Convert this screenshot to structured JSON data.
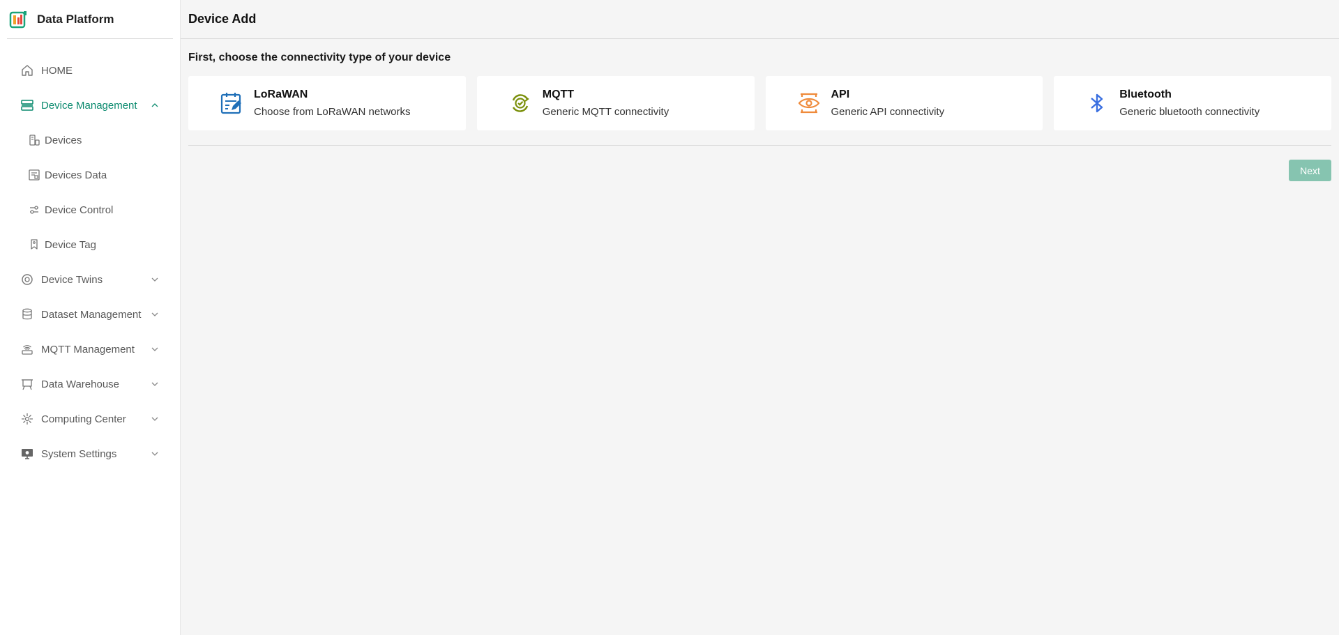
{
  "app": {
    "name": "Data Platform",
    "logo_icon": "data-platform-logo"
  },
  "colors": {
    "accent": "#0a8a6e",
    "lorawan": "#1f6fb8",
    "mqtt": "#7a8f0a",
    "api": "#ef8a3a",
    "bluetooth": "#3a6fe0",
    "next_button": "#86c4b0"
  },
  "sidebar": {
    "items": [
      {
        "label": "HOME",
        "icon": "home-icon"
      },
      {
        "label": "Device Management",
        "icon": "server-icon",
        "expanded": true,
        "active": true
      },
      {
        "label": "Devices",
        "icon": "devices-icon"
      },
      {
        "label": "Devices Data",
        "icon": "devices-data-icon"
      },
      {
        "label": "Device Control",
        "icon": "sliders-icon"
      },
      {
        "label": "Device Tag",
        "icon": "tag-icon"
      },
      {
        "label": "Device Twins",
        "icon": "twins-icon"
      },
      {
        "label": "Dataset Management",
        "icon": "database-icon"
      },
      {
        "label": "MQTT Management",
        "icon": "router-icon"
      },
      {
        "label": "Data Warehouse",
        "icon": "warehouse-icon"
      },
      {
        "label": "Computing Center",
        "icon": "computing-icon"
      },
      {
        "label": "System Settings",
        "icon": "monitor-settings-icon"
      }
    ]
  },
  "header": {
    "title": "Device Add"
  },
  "main": {
    "subtitle": "First, choose the connectivity type of your device",
    "cards": [
      {
        "title": "LoRaWAN",
        "description": "Choose from LoRaWAN networks",
        "icon": "lorawan-icon"
      },
      {
        "title": "MQTT",
        "description": "Generic MQTT connectivity",
        "icon": "mqtt-icon"
      },
      {
        "title": "API",
        "description": "Generic API connectivity",
        "icon": "api-icon"
      },
      {
        "title": "Bluetooth",
        "description": "Generic bluetooth connectivity",
        "icon": "bluetooth-icon"
      }
    ],
    "next_label": "Next"
  }
}
